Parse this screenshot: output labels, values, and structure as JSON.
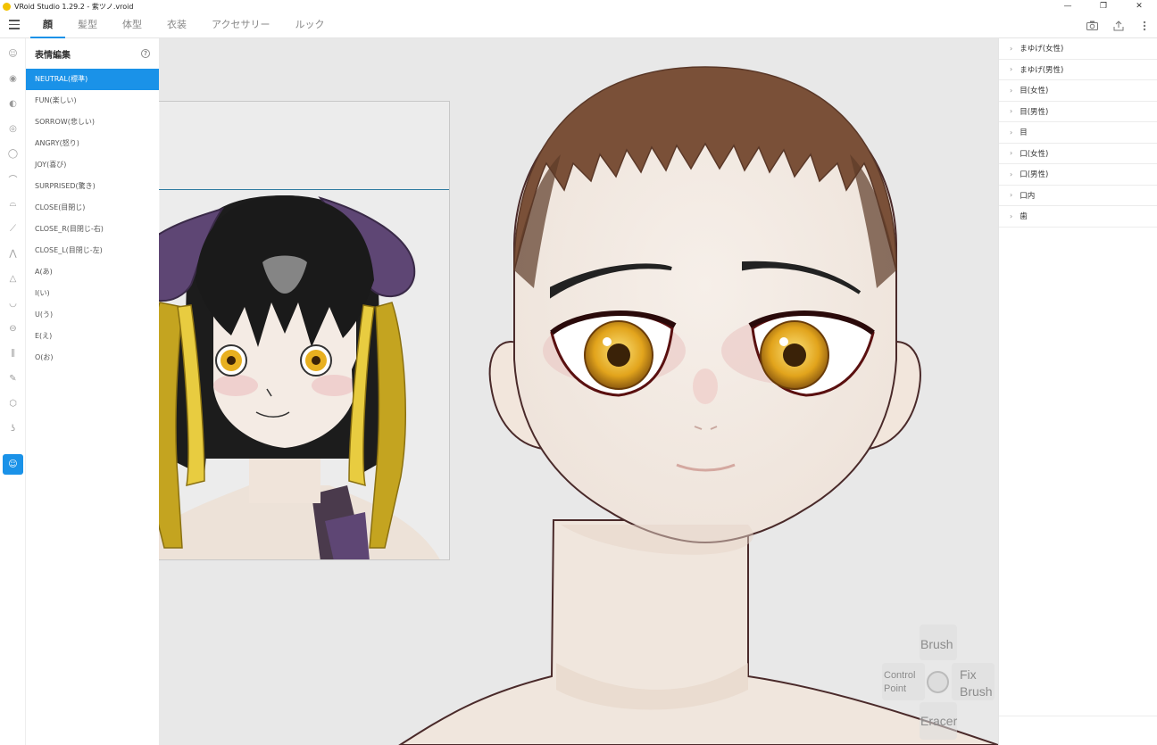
{
  "window": {
    "title": "VRoid Studio 1.29.2 - 紫ツノ.vroid"
  },
  "tabs": [
    {
      "label": "顔",
      "active": true
    },
    {
      "label": "髪型",
      "active": false
    },
    {
      "label": "体型",
      "active": false
    },
    {
      "label": "衣装",
      "active": false
    },
    {
      "label": "アクセサリー",
      "active": false
    },
    {
      "label": "ルック",
      "active": false
    }
  ],
  "panel": {
    "title": "表情編集",
    "help": "?",
    "expressions": [
      "NEUTRAL(標準)",
      "FUN(楽しい)",
      "SORROW(悲しい)",
      "ANGRY(怒り)",
      "JOY(喜び)",
      "SURPRISED(驚き)",
      "CLOSE(目閉じ)",
      "CLOSE_R(目閉じ-右)",
      "CLOSE_L(目閉じ-左)",
      "A(あ)",
      "I(い)",
      "U(う)",
      "E(え)",
      "O(お)"
    ],
    "active_index": 0
  },
  "right_panel": {
    "items": [
      "まゆげ(女性)",
      "まゆげ(男性)",
      "目(女性)",
      "目(男性)",
      "目",
      "口(女性)",
      "口(男性)",
      "口内",
      "歯"
    ]
  },
  "gesture": {
    "up": "Brush",
    "left_line1": "Control",
    "left_line2": "Point",
    "right_line1": "Fix",
    "right_line2": "Brush",
    "down": "Eracer"
  },
  "icons": {
    "menu": "hamburger-icon",
    "camera": "camera-icon",
    "export": "export-icon",
    "more": "more-vert-icon"
  },
  "colors": {
    "accent": "#1a92e8",
    "hair_brown": "#7a5038",
    "eye_gold": "#e8b020",
    "horn_purple": "#5e4674"
  }
}
